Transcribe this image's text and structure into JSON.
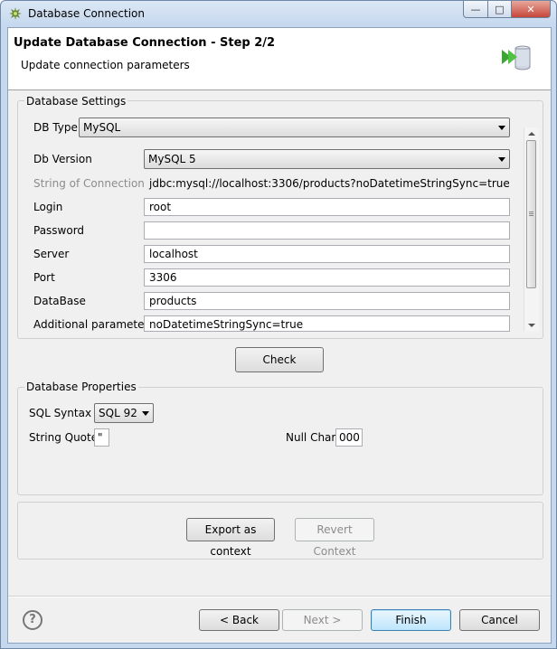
{
  "window": {
    "title": "Database Connection",
    "buttons": {
      "minimize": "—",
      "maximize": "□",
      "close": "✕"
    }
  },
  "header": {
    "title": "Update Database Connection - Step 2/2",
    "subtitle": "Update connection parameters",
    "icon": "database-arrow-icon"
  },
  "db_settings": {
    "group_label": "Database Settings",
    "db_type": {
      "label": "DB Type",
      "value": "MySQL"
    },
    "db_version": {
      "label": "Db Version",
      "value": "MySQL 5"
    },
    "connection_string": {
      "label": "String of Connection",
      "value": "jdbc:mysql://localhost:3306/products?noDatetimeStringSync=true"
    },
    "login": {
      "label": "Login",
      "value": "root"
    },
    "password": {
      "label": "Password",
      "value": ""
    },
    "server": {
      "label": "Server",
      "value": "localhost"
    },
    "port": {
      "label": "Port",
      "value": "3306"
    },
    "database": {
      "label": "DataBase",
      "value": "products"
    },
    "additional": {
      "label": "Additional parameters",
      "value": "noDatetimeStringSync=true"
    }
  },
  "check_button": "Check",
  "db_properties": {
    "group_label": "Database Properties",
    "sql_syntax": {
      "label": "SQL Syntax",
      "value": "SQL 92"
    },
    "string_quote": {
      "label": "String Quote",
      "value": "\""
    },
    "null_char": {
      "label": "Null Char",
      "value": "000"
    }
  },
  "context": {
    "export_label": "Export as context",
    "revert_label": "Revert Context"
  },
  "footer": {
    "help": "?",
    "back_label": "< Back",
    "next_label": "Next >",
    "finish_label": "Finish",
    "cancel_label": "Cancel"
  },
  "colors": {
    "title_bar": "#c5d8ee",
    "dialog_bg": "#f0f0f0",
    "default_button": "#bee6fd"
  }
}
